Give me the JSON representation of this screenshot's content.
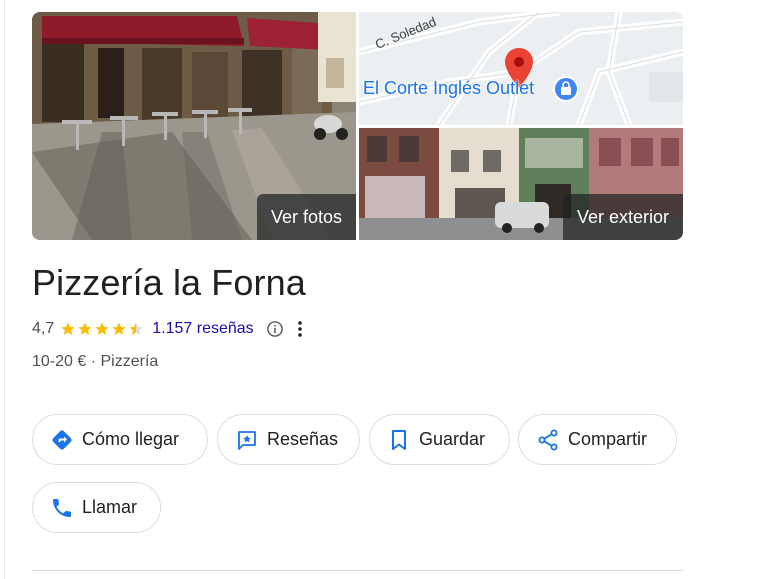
{
  "photos": {
    "main_button_label": "Ver fotos",
    "street_button_label": "Ver exterior",
    "map": {
      "street_label": "C. Soledad",
      "place_label": "El Corte Inglés Outlet",
      "pin_icon": "map-pin-icon",
      "shop_icon": "shopping-bag-icon"
    }
  },
  "place": {
    "title": "Pizzería la Forna",
    "rating": "4,7",
    "stars": 4.7,
    "reviews_label": "1.157 reseñas",
    "price_category": "10-20 € · Pizzería"
  },
  "actions": {
    "directions_label": "Cómo llegar",
    "reviews_label": "Reseñas",
    "save_label": "Guardar",
    "share_label": "Compartir",
    "call_label": "Llamar"
  },
  "colors": {
    "accent_blue": "#1a73e8",
    "link": "#1a0dab",
    "star": "#fbbc04",
    "chip_border": "#dadce0",
    "text_secondary": "#4d5156"
  }
}
